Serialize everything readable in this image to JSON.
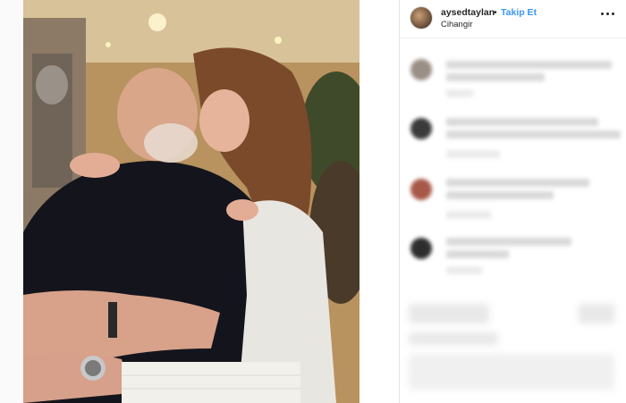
{
  "post": {
    "username": "aysedtaylan",
    "separator": "•",
    "follow_label": "Takip Et",
    "location": "Cihangir"
  },
  "icons": {
    "more": "more-horizontal-icon",
    "avatar": "profile-avatar"
  },
  "colors": {
    "follow_link": "#3897f0",
    "text": "#262626"
  }
}
